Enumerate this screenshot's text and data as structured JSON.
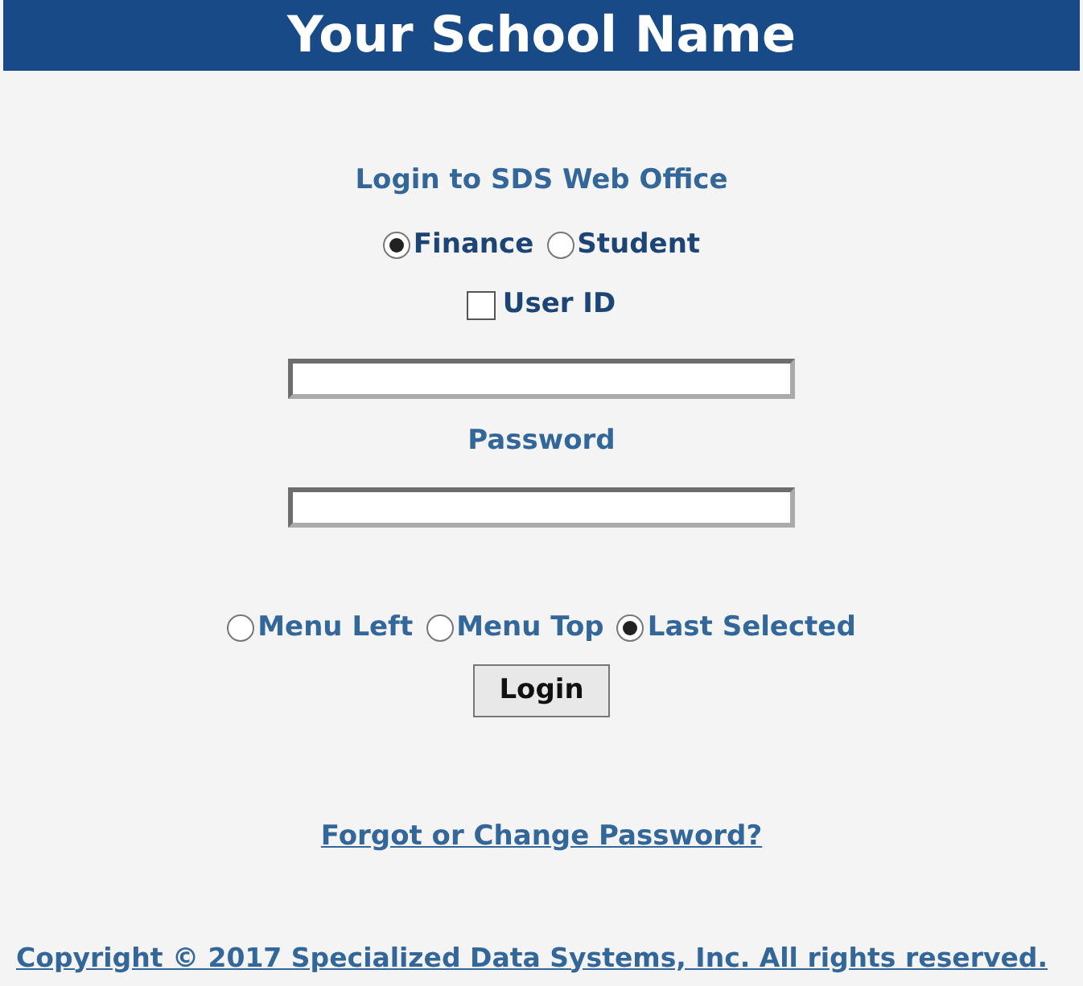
{
  "header": {
    "title": "Your School Name"
  },
  "login": {
    "heading": "Login to SDS Web Office",
    "system_options": [
      {
        "label": "Finance",
        "selected": true
      },
      {
        "label": "Student",
        "selected": false
      }
    ],
    "user_id": {
      "label": "User ID",
      "checked": false
    },
    "password_label": "Password",
    "view_options": [
      {
        "label": "Menu Left",
        "selected": false
      },
      {
        "label": "Menu Top",
        "selected": false
      },
      {
        "label": "Last Selected",
        "selected": true
      }
    ],
    "button": "Login",
    "forgot_link": "Forgot or Change Password?"
  },
  "footer": {
    "copyright": "Copyright © 2017 Specialized Data Systems, Inc. All rights reserved."
  }
}
